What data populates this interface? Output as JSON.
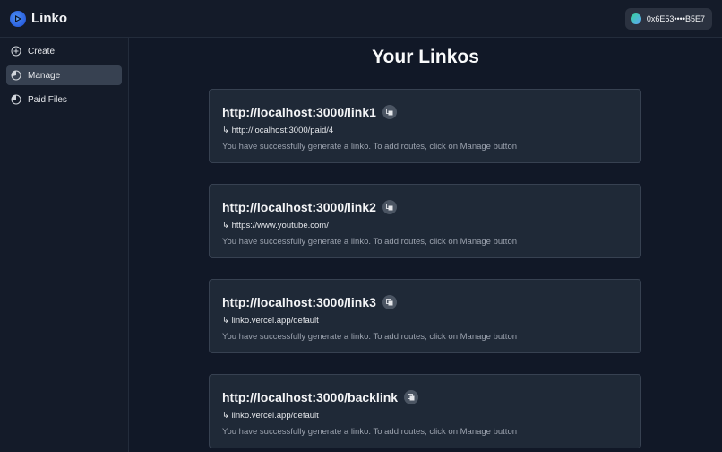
{
  "app": {
    "name": "Linko"
  },
  "wallet": {
    "address": "0x6E53••••B5E7"
  },
  "sidebar": {
    "items": [
      {
        "label": "Create",
        "icon": "plus-circle-icon",
        "active": false
      },
      {
        "label": "Manage",
        "icon": "pie-chart-icon",
        "active": true
      },
      {
        "label": "Paid Files",
        "icon": "pie-chart-icon",
        "active": false
      }
    ]
  },
  "main": {
    "title": "Your Linkos",
    "cards": [
      {
        "url": "http://localhost:3000/link1",
        "target": "↳ http://localhost:3000/paid/4",
        "message": "You have successfully generate a linko. To add routes, click on Manage button"
      },
      {
        "url": "http://localhost:3000/link2",
        "target": "↳ https://www.youtube.com/",
        "message": "You have successfully generate a linko. To add routes, click on Manage button"
      },
      {
        "url": "http://localhost:3000/link3",
        "target": "↳ linko.vercel.app/default",
        "message": "You have successfully generate a linko. To add routes, click on Manage button"
      },
      {
        "url": "http://localhost:3000/backlink",
        "target": "↳ linko.vercel.app/default",
        "message": "You have successfully generate a linko. To add routes, click on Manage button"
      }
    ]
  },
  "colors": {
    "background": "#111827",
    "card": "#1f2937",
    "accent": "#2563eb",
    "active_item": "#374151"
  }
}
